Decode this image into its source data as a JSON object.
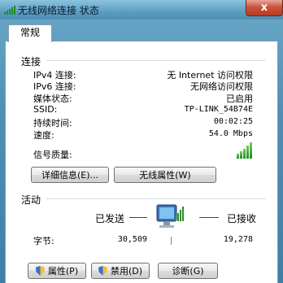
{
  "window": {
    "title": "无线网络连接 状态",
    "close_label": "x"
  },
  "tabs": [
    {
      "label": "常规"
    }
  ],
  "connection": {
    "section_label": "连接",
    "rows": [
      {
        "label": "IPv4 连接:",
        "value": "无 Internet 访问权限"
      },
      {
        "label": "IPv6 连接:",
        "value": "无网络访问权限"
      },
      {
        "label": "媒体状态:",
        "value": "已启用"
      },
      {
        "label": "SSID:",
        "value": "TP-LINK_54B74E"
      },
      {
        "label": "持续时间:",
        "value": "00:02:25"
      },
      {
        "label": "速度:",
        "value": "54.0 Mbps"
      }
    ],
    "signal_label": "信号质量:",
    "signal_bars": 5,
    "details_button": "详细信息(E)...",
    "wireless_props_button": "无线属性(W)"
  },
  "activity": {
    "section_label": "活动",
    "sent_label": "已发送",
    "received_label": "已接收",
    "bytes_label": "字节:",
    "bytes_sent": "30,509",
    "bytes_received": "19,278"
  },
  "bottom_buttons": {
    "properties": "属性(P)",
    "disable": "禁用(D)",
    "diagnose": "诊断(G)"
  }
}
